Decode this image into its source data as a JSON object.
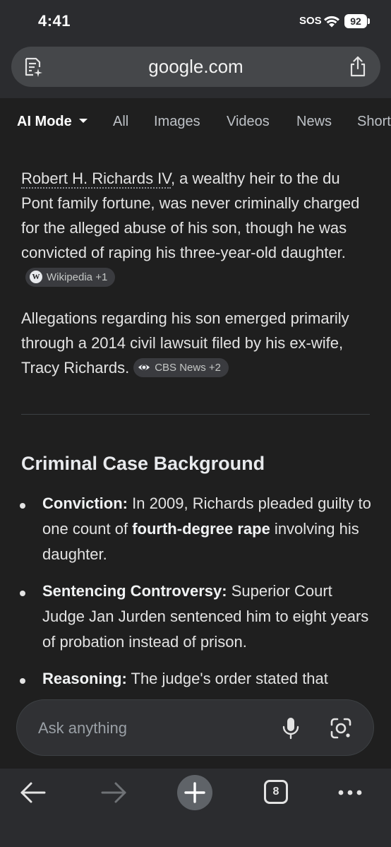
{
  "status_bar": {
    "time": "4:41",
    "sos": "SOS",
    "battery": "92"
  },
  "browser": {
    "url": "google.com"
  },
  "tabs": [
    {
      "label": "AI Mode",
      "active": true
    },
    {
      "label": "All"
    },
    {
      "label": "Images"
    },
    {
      "label": "Videos"
    },
    {
      "label": "News"
    },
    {
      "label": "Short"
    }
  ],
  "content": {
    "para1": {
      "link": "Robert H. Richards IV",
      "text": ", a wealthy heir to the du Pont family fortune, was never criminally charged for the alleged abuse of his son, though he was convicted of raping his three-year-old daughter.",
      "chip_icon": "W",
      "chip": "Wikipedia +1"
    },
    "para2": {
      "text": "Allegations regarding his son emerged primarily through a 2014 civil lawsuit filed by his ex-wife, Tracy Richards.",
      "chip": "CBS News +2"
    },
    "section_heading": "Criminal Case Background",
    "bullets": [
      {
        "label": "Conviction:",
        "text_before": " In 2009, Richards pleaded guilty to one count of ",
        "bold": "fourth-degree rape",
        "text_after": " involving his daughter."
      },
      {
        "label": "Sentencing Controversy:",
        "text": " Superior Court Judge Jan Jurden sentenced him to eight years of probation instead of prison."
      },
      {
        "label": "Reasoning:",
        "text": " The judge's order stated that"
      }
    ]
  },
  "ask_bar": {
    "placeholder": "Ask anything"
  },
  "bottom_nav": {
    "tab_count": "8"
  },
  "icons": [
    "wifi-icon",
    "tab-ai-icon",
    "share-icon",
    "mic-icon",
    "google-lens-icon",
    "back-arrow-icon",
    "forward-arrow-icon",
    "plus-icon",
    "more-icon"
  ]
}
